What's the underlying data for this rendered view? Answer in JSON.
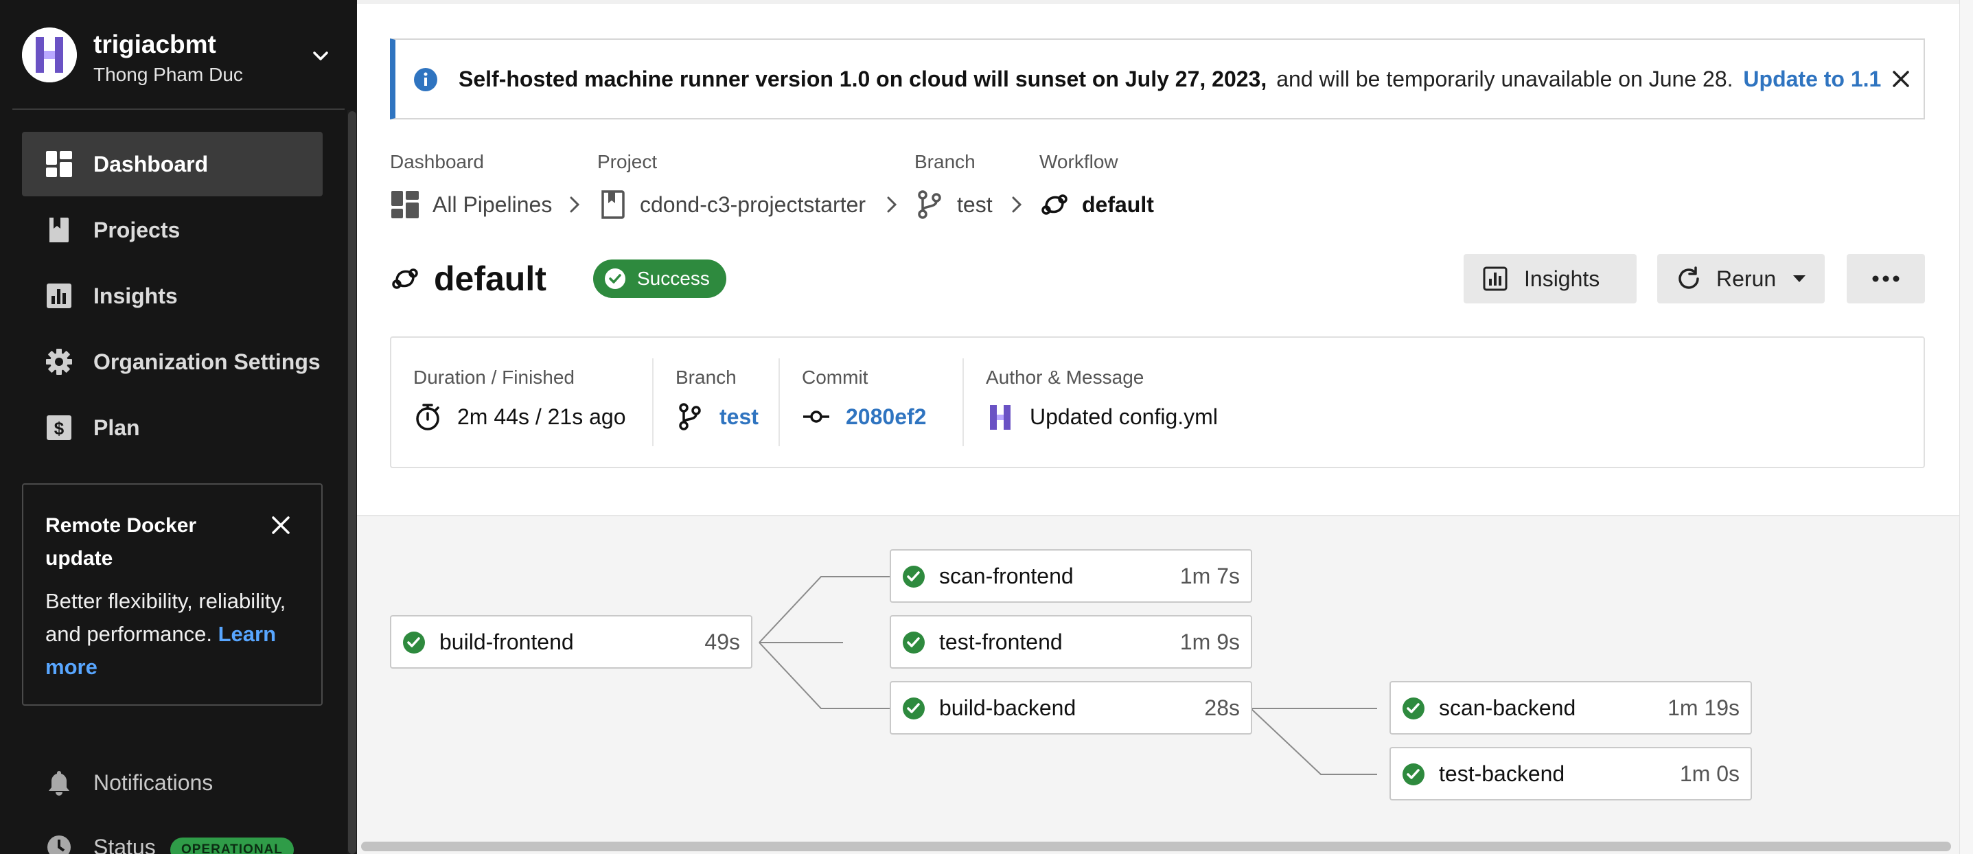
{
  "org": {
    "name": "trigiacbmt",
    "user": "Thong Pham Duc"
  },
  "nav": [
    {
      "id": "dashboard",
      "label": "Dashboard",
      "icon": "dashboard-icon",
      "active": true
    },
    {
      "id": "projects",
      "label": "Projects",
      "icon": "book-icon"
    },
    {
      "id": "insights",
      "label": "Insights",
      "icon": "bar-chart-icon"
    },
    {
      "id": "org-settings",
      "label": "Organization Settings",
      "icon": "gear-icon"
    },
    {
      "id": "plan",
      "label": "Plan",
      "icon": "dollar-icon"
    }
  ],
  "promo": {
    "title": "Remote Docker update",
    "body": "Better flexibility, reliability, and performance.",
    "link": "Learn more"
  },
  "bottom": {
    "notifications": "Notifications",
    "status": "Status",
    "status_badge": "OPERATIONAL"
  },
  "banner": {
    "bold": "Self-hosted machine runner version 1.0 on cloud will sunset on July 27, 2023,",
    "text": "and will be temporarily unavailable on June 28.",
    "link": "Update to 1.1"
  },
  "breadcrumb": {
    "labels": {
      "dashboard": "Dashboard",
      "project": "Project",
      "branch": "Branch",
      "workflow": "Workflow"
    },
    "values": {
      "dashboard": "All Pipelines",
      "project": "cdond-c3-projectstarter",
      "branch": "test",
      "workflow": "default"
    }
  },
  "workflow": {
    "name": "default",
    "status": "Success",
    "actions": {
      "insights": "Insights",
      "rerun": "Rerun"
    }
  },
  "summary": {
    "duration_label": "Duration / Finished",
    "duration_value": "2m 44s / 21s ago",
    "branch_label": "Branch",
    "branch_value": "test",
    "commit_label": "Commit",
    "commit_value": "2080ef2",
    "author_label": "Author & Message",
    "author_value": "Updated config.yml"
  },
  "jobs": [
    {
      "name": "build-frontend",
      "time": "49s",
      "status": "success"
    },
    {
      "name": "scan-frontend",
      "time": "1m 7s",
      "status": "success"
    },
    {
      "name": "test-frontend",
      "time": "1m 9s",
      "status": "success"
    },
    {
      "name": "build-backend",
      "time": "28s",
      "status": "success"
    },
    {
      "name": "scan-backend",
      "time": "1m 19s",
      "status": "success"
    },
    {
      "name": "test-backend",
      "time": "1m 0s",
      "status": "success"
    }
  ],
  "colors": {
    "sidebar_bg": "#161616",
    "accent_blue": "#2f74c0",
    "success_green": "#2e8a3e",
    "operational_green": "#2f9c48",
    "brand_purple": "#6a52c4"
  }
}
